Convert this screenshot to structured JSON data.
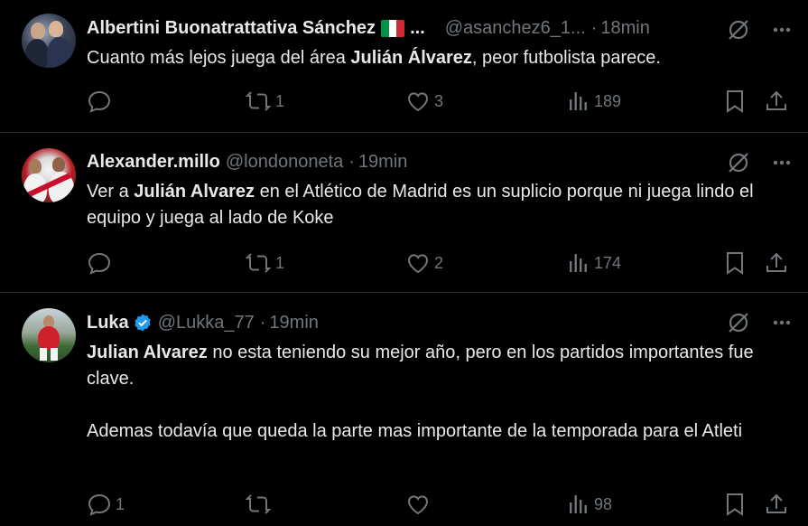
{
  "tweets": [
    {
      "name": "Albertini Buonatrattativa Sánchez",
      "name_suffix": "...",
      "handle": "@asanchez6_1...",
      "separator": "·",
      "time": "18min",
      "text": {
        "p1": "Cuanto más lejos juega del área ",
        "bold1": "Julián Álvarez",
        "p2": ", peor futbolista parece."
      },
      "replies": "",
      "retweets": "1",
      "likes": "3",
      "views": "189"
    },
    {
      "name": "Alexander.millo",
      "handle": "@londononeta",
      "separator": "·",
      "time": "19min",
      "text": {
        "p1": "Ver a ",
        "bold1": "Julián Alvarez",
        "p2": " en el Atlético de Madrid es un suplicio porque ni juega lindo el equipo y juega al lado de Koke"
      },
      "replies": "",
      "retweets": "1",
      "likes": "2",
      "views": "174"
    },
    {
      "name": "Luka",
      "handle": "@Lukka_77",
      "separator": "·",
      "time": "19min",
      "text": {
        "bold1": "Julian Alvarez",
        "p1": " no esta teniendo su mejor año, pero en los partidos importantes fue clave.",
        "p2": "Ademas todavía que queda la parte mas importante de la temporada para el Atleti"
      },
      "replies": "1",
      "retweets": "",
      "likes": "",
      "views": "98"
    }
  ],
  "colors": {
    "background": "#000000",
    "text": "#e7e9ea",
    "muted": "#71767b",
    "divider": "#2f3336",
    "verified": "#1d9bf0"
  },
  "icons": [
    "reply-icon",
    "retweet-icon",
    "like-icon",
    "views-icon",
    "bookmark-icon",
    "share-icon",
    "grok-icon",
    "more-icon",
    "italy-flag-icon",
    "verified-badge-icon"
  ]
}
